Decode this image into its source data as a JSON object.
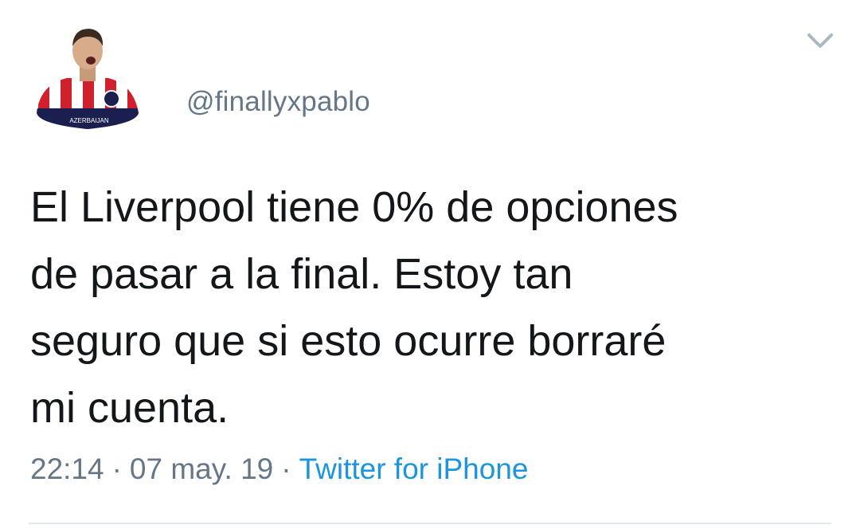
{
  "tweet": {
    "username": "@finallyxpablo",
    "text_lines": [
      "El Liverpool tiene 0% de opciones",
      "de pasar a la final. Estoy tan",
      "seguro que si esto ocurre borraré",
      "mi cuenta."
    ],
    "time": "22:14",
    "date": "07 may. 19",
    "separator": "·",
    "source": "Twitter for iPhone",
    "avatar_label": "AZERBAIJAN",
    "menu_icon": "chevron-down-icon",
    "colors": {
      "text": "#14171a",
      "secondary": "#657786",
      "link": "#1b95e0",
      "divider": "#e1e8ed"
    }
  }
}
